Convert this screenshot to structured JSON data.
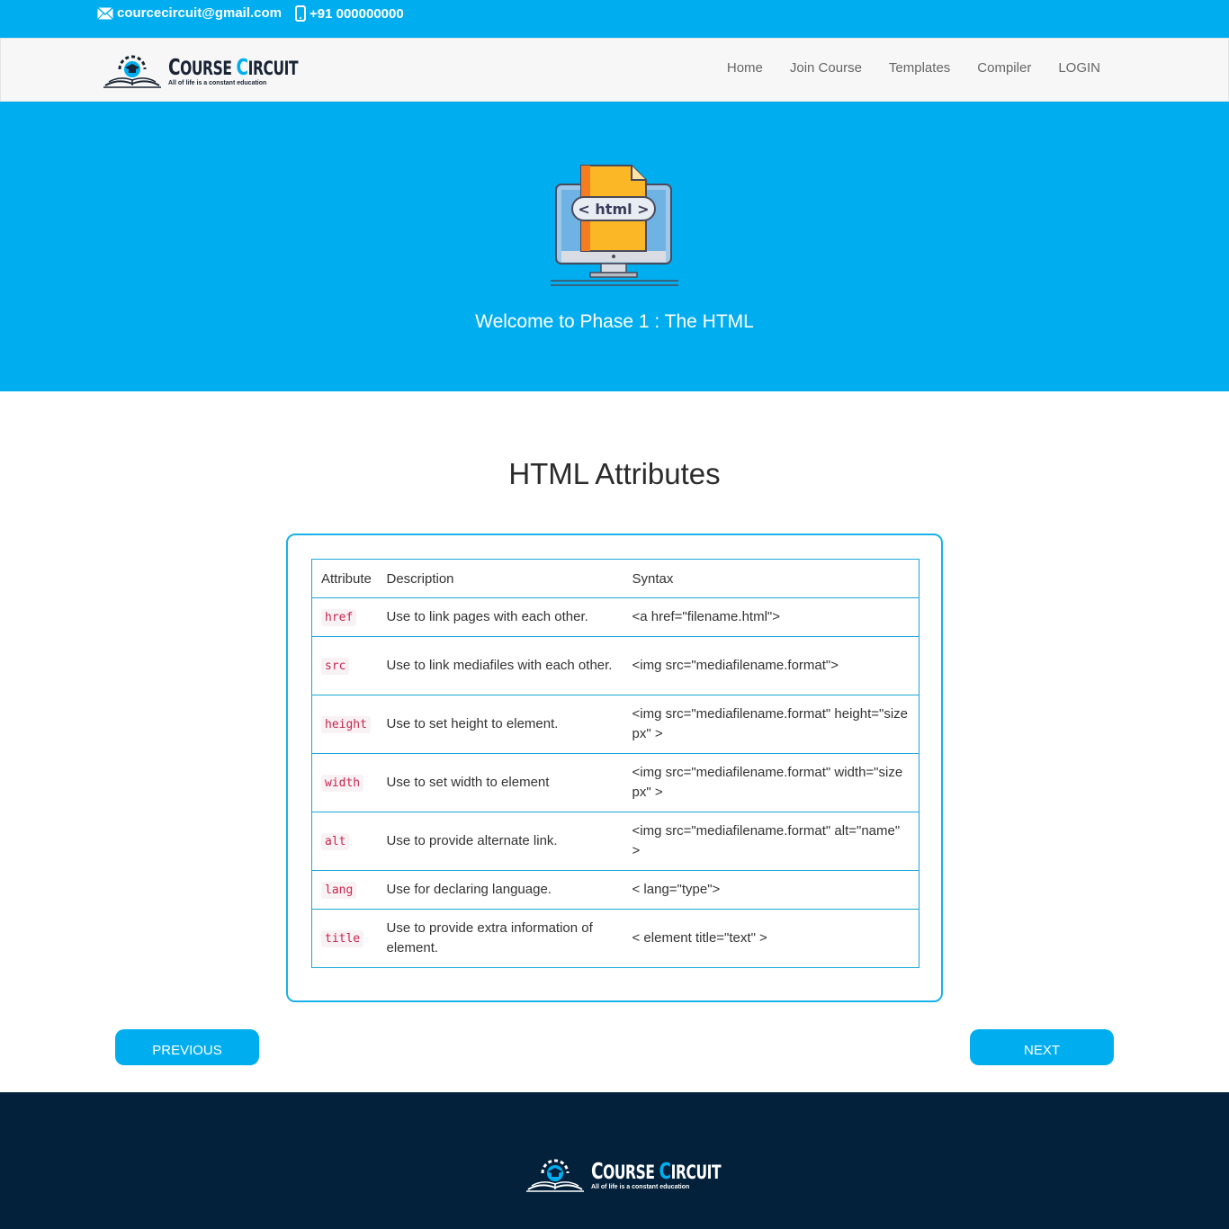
{
  "topbar": {
    "email": "courcecircuit@gmail.com",
    "phone": "+91 000000000"
  },
  "brand": {
    "name_first_cap": "C",
    "name_first_rest": "OURSE ",
    "name_second_cap": "C",
    "name_second_rest": "IRCUIT",
    "tagline": "All of life is a constant education"
  },
  "nav": {
    "items": [
      "Home",
      "Join Course",
      "Templates",
      "Compiler",
      "LOGIN"
    ]
  },
  "hero": {
    "illustration_label": "< html >",
    "title": "Welcome to Phase 1 : The HTML"
  },
  "section": {
    "title": "HTML Attributes"
  },
  "table": {
    "headers": [
      "Attribute",
      "Description",
      "Syntax"
    ],
    "rows": [
      {
        "attr": "href",
        "desc": "Use to link pages with each other.",
        "syntax": "<a href=\"filename.html\">"
      },
      {
        "attr": "src",
        "desc": "Use to link mediafiles with each other.",
        "syntax": "<img src=\"mediafilename.format\">"
      },
      {
        "attr": "height",
        "desc": "Use to set height to element.",
        "syntax": "<img src=\"mediafilename.format\" height=\"size px\" >"
      },
      {
        "attr": "width",
        "desc": "Use to set width to element",
        "syntax": "<img src=\"mediafilename.format\" width=\"size px\" >"
      },
      {
        "attr": "alt",
        "desc": "Use to provide alternate link.",
        "syntax": "<img src=\"mediafilename.format\" alt=\"name\" >"
      },
      {
        "attr": "lang",
        "desc": "Use for declaring language.",
        "syntax": "< lang=\"type\">"
      },
      {
        "attr": "title",
        "desc": "Use to provide extra information of element.",
        "syntax": "< element title=\"text\" >"
      }
    ]
  },
  "buttons": {
    "previous": "PREVIOUS",
    "next": "NEXT"
  },
  "colors": {
    "accent": "#00aeef",
    "footer": "#03213a",
    "code": "#c7254e"
  }
}
